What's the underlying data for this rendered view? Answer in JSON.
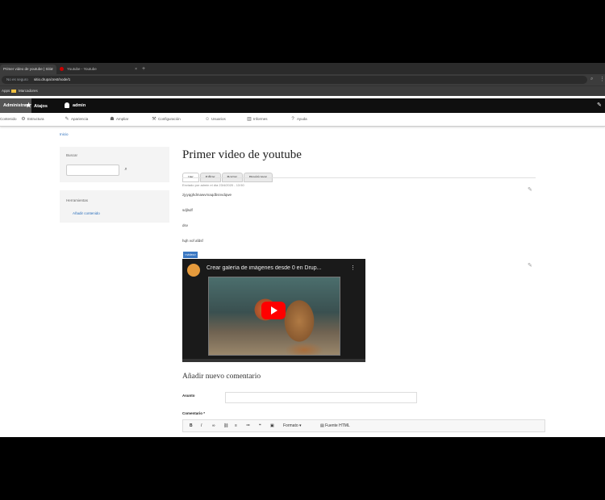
{
  "browser": {
    "tabs": [
      {
        "title": "Primer video de youtube | Sitio",
        "active": true
      },
      {
        "title": "Youtube - Youtube",
        "active": false
      }
    ],
    "new_tab": "+",
    "address": {
      "secure_label": "No es seguro",
      "url": "sitio.drupal.test/node/1"
    },
    "bookmarks": [
      "Apps",
      "Marcadores"
    ]
  },
  "toolbar": {
    "manage": "Administrar",
    "shortcuts": "Atajos",
    "user": "admin"
  },
  "admin_menu": [
    {
      "label": "Contenido",
      "icon": "file-icon"
    },
    {
      "label": "Estructura",
      "icon": "structure-icon"
    },
    {
      "label": "Apariencia",
      "icon": "brush-icon"
    },
    {
      "label": "Ampliar",
      "icon": "puzzle-icon"
    },
    {
      "label": "Configuración",
      "icon": "wrench-icon"
    },
    {
      "label": "Usuarios",
      "icon": "users-icon"
    },
    {
      "label": "Informes",
      "icon": "chart-icon"
    },
    {
      "label": "Ayuda",
      "icon": "help-icon"
    }
  ],
  "breadcrumb": "Inicio",
  "sidebar": {
    "search_label": "Buscar",
    "nav_title": "Herramientas",
    "nav_link": "Añadir contenido"
  },
  "node": {
    "title": "Primer video de youtube",
    "tabs": [
      "Ver",
      "Editar",
      "Borrar",
      "Revisiones"
    ],
    "meta": "Enviado por admin el día 23/4/2020 - 13:50",
    "body": [
      "zjyyqghdmawvmaqdbsnvdqwe",
      "sdjlsdf",
      "dsv",
      "hqh vof afdsf"
    ],
    "selected_tag": "<video>"
  },
  "video": {
    "title": "Crear galería de imágenes desde 0 en Drup..."
  },
  "comment_form": {
    "title": "Añadir nuevo comentario",
    "subject_label": "Asunto",
    "comment_label": "Comentario *",
    "editor": {
      "format_label": "Formato",
      "code_label": "Fuente HTML",
      "buttons": [
        "B",
        "I",
        "∞",
        "⛓",
        "≡",
        "≔",
        "❝",
        "▣"
      ]
    }
  },
  "colors": {
    "link": "#2a6ebb",
    "toolbar": "#0f0f0f",
    "play": "#ff0000"
  }
}
